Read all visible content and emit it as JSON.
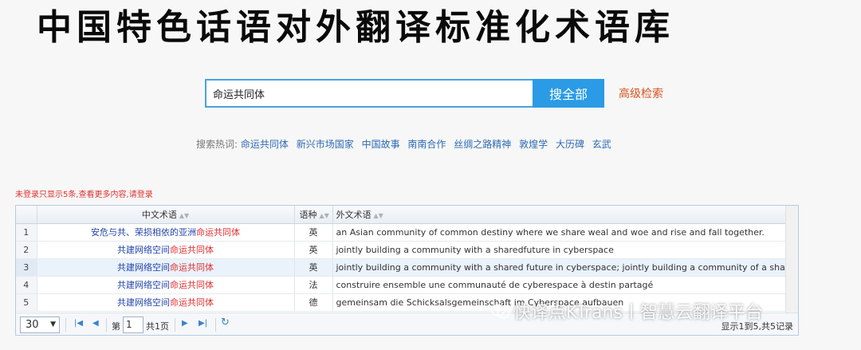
{
  "page_title": "中国特色话语对外翻译标准化术语库",
  "search": {
    "value": "命运共同体",
    "button": "搜全部",
    "advanced": "高级检索"
  },
  "hot": {
    "label": "搜索热词:",
    "items": [
      "命运共同体",
      "新兴市场国家",
      "中国故事",
      "南南合作",
      "丝绸之路精神",
      "敦煌学",
      "大历碑",
      "玄武"
    ]
  },
  "notice": "未登录只显示5条,查看更多内容,请登录",
  "table": {
    "headers": {
      "cn": "中文术语",
      "lang": "语种",
      "foreign": "外文术语"
    },
    "rows": [
      {
        "num": "1",
        "cn_prefix": "安危与共、荣损相依的亚洲",
        "cn_hl": "命运共同体",
        "lang": "英",
        "foreign": "an Asian community of common destiny where we share weal and woe and rise and fall together."
      },
      {
        "num": "2",
        "cn_prefix": "共建网络空间",
        "cn_hl": "命运共同体",
        "lang": "英",
        "foreign": "jointly building a community with a sharedfuture in cyberspace"
      },
      {
        "num": "3",
        "cn_prefix": "共建网络空间",
        "cn_hl": "命运共同体",
        "lang": "英",
        "foreign": "jointly building a community with a shared future in cyberspace; jointly building a community of a sha"
      },
      {
        "num": "4",
        "cn_prefix": "共建网络空间",
        "cn_hl": "命运共同体",
        "lang": "法",
        "foreign": "construire ensemble une communauté de cyberespace à destin partagé"
      },
      {
        "num": "5",
        "cn_prefix": "共建网络空间",
        "cn_hl": "命运共同体",
        "lang": "德",
        "foreign": "gemeinsam die Schicksalsgemeinschaft im Cyberspace aufbauen"
      }
    ]
  },
  "pager": {
    "page_size": "30",
    "page_prefix": "第",
    "page_value": "1",
    "page_total": "共1页",
    "summary": "显示1到5,共5记录"
  },
  "watermark": "快译点KTrans丨智慧云翻译平台",
  "icons": {
    "first": "first-page-icon",
    "prev": "prev-page-icon",
    "next": "next-page-icon",
    "last": "last-page-icon",
    "refresh": "refresh-icon",
    "sort": "sort-icon",
    "wechat": "wechat-icon"
  }
}
